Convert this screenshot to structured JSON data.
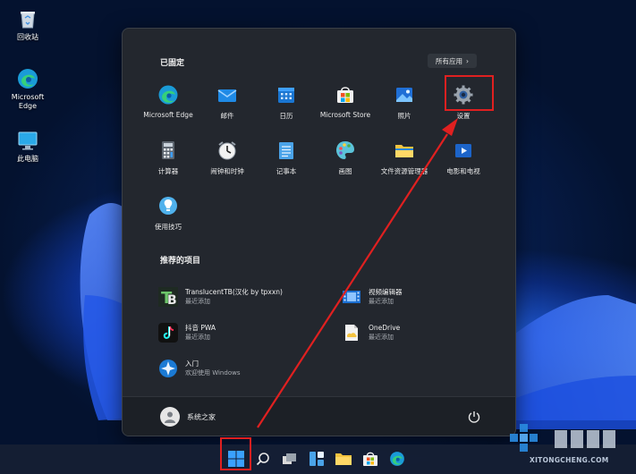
{
  "desktop": {
    "icons": [
      {
        "label": "回收站",
        "icon": "recycle-bin-icon"
      },
      {
        "label": "Microsoft\nEdge",
        "icon": "edge-icon"
      },
      {
        "label": "此电脑",
        "icon": "this-pc-icon"
      }
    ]
  },
  "start_menu": {
    "pinned_title": "已固定",
    "all_apps_label": "所有应用",
    "all_apps_chevron": "›",
    "pinned": [
      {
        "label": "Microsoft Edge",
        "icon": "edge-icon"
      },
      {
        "label": "邮件",
        "icon": "mail-icon"
      },
      {
        "label": "日历",
        "icon": "calendar-icon"
      },
      {
        "label": "Microsoft Store",
        "icon": "store-icon"
      },
      {
        "label": "照片",
        "icon": "photos-icon"
      },
      {
        "label": "设置",
        "icon": "settings-gear-icon"
      },
      {
        "label": "计算器",
        "icon": "calculator-icon"
      },
      {
        "label": "闹钟和时钟",
        "icon": "alarm-clock-icon"
      },
      {
        "label": "记事本",
        "icon": "notepad-icon"
      },
      {
        "label": "画图",
        "icon": "paint-icon"
      },
      {
        "label": "文件资源管理器",
        "icon": "file-explorer-icon"
      },
      {
        "label": "电影和电视",
        "icon": "movies-tv-icon"
      },
      {
        "label": "使用技巧",
        "icon": "tips-icon"
      }
    ],
    "recommended_title": "推荐的项目",
    "recommended": [
      {
        "name": "TranslucentTB(汉化 by tpxxn)",
        "sub": "最近添加",
        "icon": "translucenttb-icon"
      },
      {
        "name": "视频编辑器",
        "sub": "最近添加",
        "icon": "video-editor-icon"
      },
      {
        "name": "抖音 PWA",
        "sub": "最近添加",
        "icon": "douyin-icon"
      },
      {
        "name": "OneDrive",
        "sub": "最近添加",
        "icon": "onedrive-icon"
      },
      {
        "name": "入门",
        "sub": "欢迎使用 Windows",
        "icon": "get-started-icon"
      }
    ],
    "user_name": "系统之家"
  },
  "watermark": {
    "text": "XITONGCHENG.COM"
  },
  "colors": {
    "accent": "#0078d4",
    "highlight": "#e02020",
    "menu_bg": "#23272e"
  }
}
